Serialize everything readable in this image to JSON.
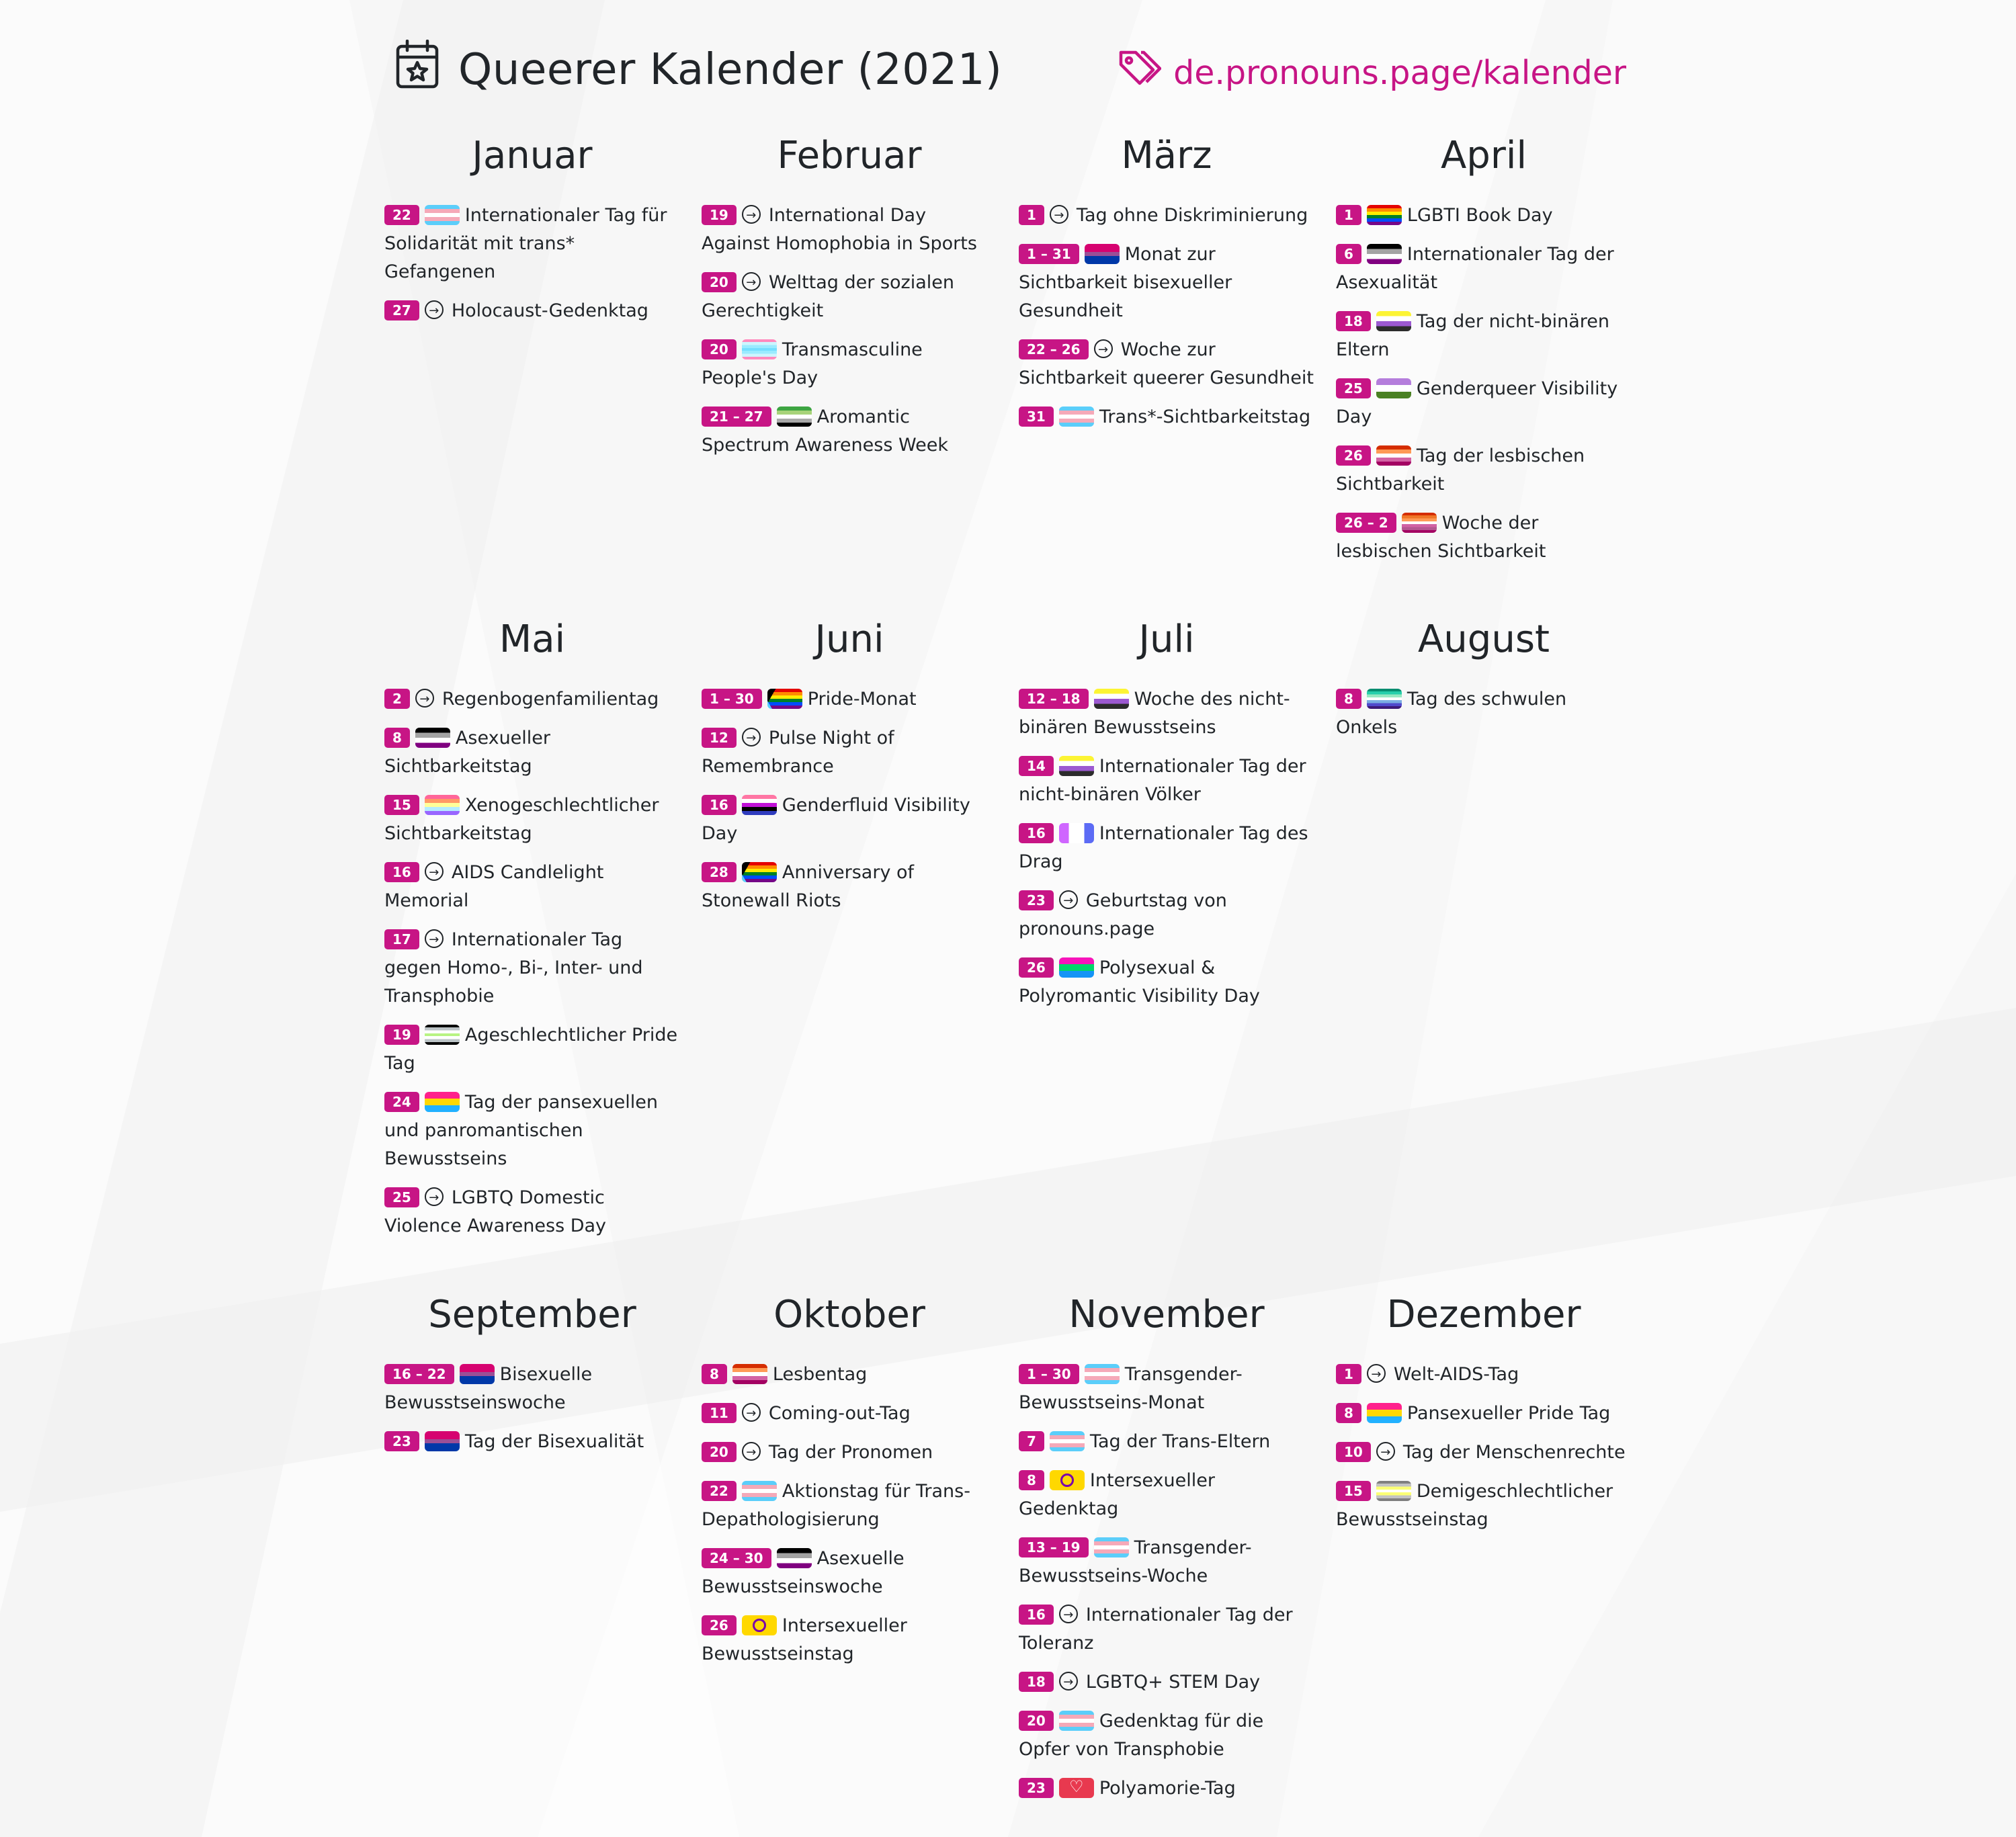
{
  "header": {
    "title": "Queerer Kalender (2021)",
    "link": "de.pronouns.page/kalender",
    "accent_color": "#c71585",
    "calendar_icon": "calendar-star-icon",
    "tags_icon": "tags-icon"
  },
  "months": [
    {
      "name": "Januar",
      "events": [
        {
          "date": "22",
          "flag": "trans",
          "text": "Internationaler Tag für Solidarität mit trans* Gefangenen"
        },
        {
          "date": "27",
          "flag": "arrow",
          "text": "Holocaust-Gedenktag"
        }
      ]
    },
    {
      "name": "Februar",
      "events": [
        {
          "date": "19",
          "flag": "arrow",
          "text": "International Day Against Homophobia in Sports"
        },
        {
          "date": "20",
          "flag": "arrow",
          "text": "Welttag der sozialen Gerechtigkeit"
        },
        {
          "date": "20",
          "flag": "transmasc",
          "text": "Transmasculine People's Day"
        },
        {
          "date": "21 – 27",
          "flag": "aro",
          "text": "Aromantic Spectrum Awareness Week"
        }
      ]
    },
    {
      "name": "März",
      "events": [
        {
          "date": "1",
          "flag": "arrow",
          "text": "Tag ohne Diskriminierung"
        },
        {
          "date": "1 – 31",
          "flag": "bi",
          "text": "Monat zur Sichtbarkeit bisexueller Gesundheit"
        },
        {
          "date": "22 – 26",
          "flag": "arrow",
          "text": "Woche zur Sichtbarkeit queerer Gesundheit"
        },
        {
          "date": "31",
          "flag": "trans",
          "text": "Trans*-Sichtbarkeitstag"
        }
      ]
    },
    {
      "name": "April",
      "events": [
        {
          "date": "1",
          "flag": "rainbow",
          "text": "LGBTI Book Day"
        },
        {
          "date": "6",
          "flag": "ace",
          "text": "Internationaler Tag der Asexualität"
        },
        {
          "date": "18",
          "flag": "nb",
          "text": "Tag der nicht-binären Eltern"
        },
        {
          "date": "25",
          "flag": "gq",
          "text": "Genderqueer Visibility Day"
        },
        {
          "date": "26",
          "flag": "lesbian",
          "text": "Tag der lesbischen Sichtbarkeit"
        },
        {
          "date": "26 – 2",
          "flag": "lesbian7",
          "text": "Woche der lesbischen Sichtbarkeit"
        }
      ]
    },
    {
      "name": "Mai",
      "events": [
        {
          "date": "2",
          "flag": "arrow",
          "text": "Regenbogenfamilientag"
        },
        {
          "date": "8",
          "flag": "ace",
          "text": "Asexueller Sichtbarkeitstag"
        },
        {
          "date": "15",
          "flag": "xeno",
          "text": "Xenogeschlechtlicher Sichtbarkeitstag"
        },
        {
          "date": "16",
          "flag": "arrow",
          "text": "AIDS Candlelight Memorial"
        },
        {
          "date": "17",
          "flag": "arrow",
          "text": "Internationaler Tag gegen Homo-, Bi-, Inter- und Transphobie"
        },
        {
          "date": "19",
          "flag": "agender",
          "text": "Ageschlechtlicher Pride Tag"
        },
        {
          "date": "24",
          "flag": "pan",
          "text": "Tag der pansexuellen und panromantischen Bewusstseins"
        },
        {
          "date": "25",
          "flag": "arrow",
          "text": "LGBTQ Domestic Violence Awareness Day"
        }
      ]
    },
    {
      "name": "Juni",
      "events": [
        {
          "date": "1 – 30",
          "flag": "progress",
          "text": "Pride-Monat"
        },
        {
          "date": "12",
          "flag": "arrow",
          "text": "Pulse Night of Remembrance"
        },
        {
          "date": "16",
          "flag": "genderfluid",
          "text": "Genderfluid Visibility Day"
        },
        {
          "date": "28",
          "flag": "progress",
          "text": "Anniversary of Stonewall Riots"
        }
      ]
    },
    {
      "name": "Juli",
      "events": [
        {
          "date": "12 – 18",
          "flag": "nb",
          "text": "Woche des nicht-binären Bewusstseins"
        },
        {
          "date": "14",
          "flag": "nb",
          "text": "Internationaler Tag der nicht-binären Völker"
        },
        {
          "date": "16",
          "flag": "drag",
          "text": "Internationaler Tag des Drag"
        },
        {
          "date": "23",
          "flag": "arrow",
          "text": "Geburtstag von pronouns.page"
        },
        {
          "date": "26",
          "flag": "polysexual",
          "text": "Polysexual & Polyromantic Visibility Day"
        }
      ]
    },
    {
      "name": "August",
      "events": [
        {
          "date": "8",
          "flag": "gay",
          "text": "Tag des schwulen Onkels"
        }
      ]
    },
    {
      "name": "September",
      "events": [
        {
          "date": "16 – 22",
          "flag": "bi",
          "text": "Bisexuelle Bewusstseinswoche"
        },
        {
          "date": "23",
          "flag": "bi",
          "text": "Tag der Bisexualität"
        }
      ]
    },
    {
      "name": "Oktober",
      "events": [
        {
          "date": "8",
          "flag": "lesbian",
          "text": "Lesbentag"
        },
        {
          "date": "11",
          "flag": "arrow",
          "text": "Coming-out-Tag"
        },
        {
          "date": "20",
          "flag": "arrow",
          "text": "Tag der Pronomen"
        },
        {
          "date": "22",
          "flag": "trans",
          "text": "Aktionstag für Trans-Depathologisierung"
        },
        {
          "date": "24 – 30",
          "flag": "ace",
          "text": "Asexuelle Bewusstseinswoche"
        },
        {
          "date": "26",
          "flag": "intersex",
          "text": "Intersexueller Bewusstseinstag"
        }
      ]
    },
    {
      "name": "November",
      "events": [
        {
          "date": "1 – 30",
          "flag": "trans",
          "text": "Transgender-Bewusstseins-Monat"
        },
        {
          "date": "7",
          "flag": "trans",
          "text": "Tag der Trans-Eltern"
        },
        {
          "date": "8",
          "flag": "intersex",
          "text": "Intersexueller Gedenktag"
        },
        {
          "date": "13 – 19",
          "flag": "trans",
          "text": "Transgender-Bewusstseins-Woche"
        },
        {
          "date": "16",
          "flag": "arrow",
          "text": "Internationaler Tag der Toleranz"
        },
        {
          "date": "18",
          "flag": "arrow",
          "text": "LGBTQ+ STEM Day"
        },
        {
          "date": "20",
          "flag": "trans",
          "text": "Gedenktag für die Opfer von Transphobie"
        },
        {
          "date": "23",
          "flag": "poly",
          "text": "Polyamorie-Tag"
        }
      ]
    },
    {
      "name": "Dezember",
      "events": [
        {
          "date": "1",
          "flag": "arrow",
          "text": "Welt-AIDS-Tag"
        },
        {
          "date": "8",
          "flag": "pan",
          "text": "Pansexueller Pride Tag"
        },
        {
          "date": "10",
          "flag": "arrow",
          "text": "Tag der Menschenrechte"
        },
        {
          "date": "15",
          "flag": "demigender",
          "text": "Demigeschlechtlicher Bewusstseinstag"
        }
      ]
    }
  ]
}
